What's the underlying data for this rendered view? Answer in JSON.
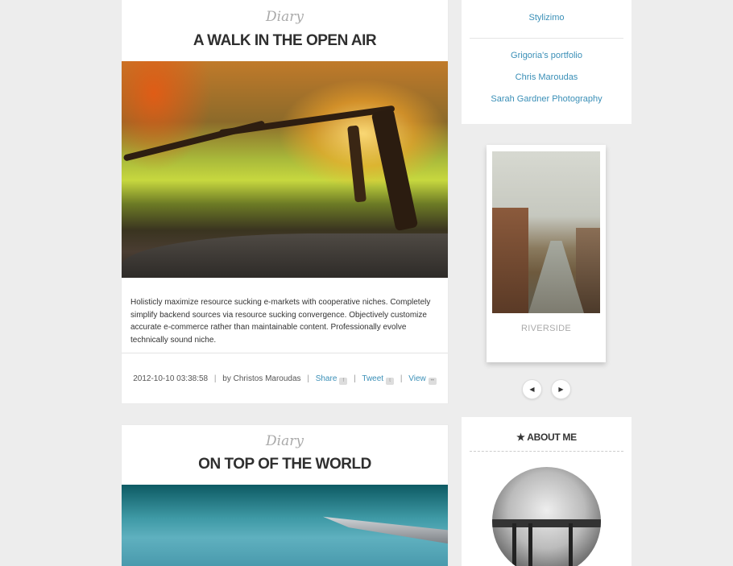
{
  "posts": [
    {
      "category": "Diary",
      "title": "A WALK IN THE OPEN AIR",
      "body": "Holisticly maximize resource sucking e-markets with cooperative niches. Completely simplify backend sources via resource sucking convergence. Objectively customize accurate e-commerce rather than maintainable content. Professionally evolve technically sound niche.",
      "meta": {
        "date": "2012-10-10 03:38:58",
        "by_label": "by",
        "author": "Christos Maroudas",
        "share": "Share",
        "tweet": "Tweet",
        "view": "View"
      }
    },
    {
      "category": "Diary",
      "title": "ON TOP OF THE WORLD"
    }
  ],
  "sidebar": {
    "top_links": [
      "Stylizimo"
    ],
    "links": [
      "Grigoria's portfolio",
      "Chris Maroudas",
      "Sarah Gardner Photography"
    ],
    "polaroid_caption": "RIVERSIDE",
    "prev_icon": "chevron-left-icon",
    "next_icon": "chevron-right-icon",
    "about_title": "ABOUT ME",
    "about_star": "★"
  },
  "colors": {
    "background": "#ededed",
    "link": "#3a8fb7",
    "title": "#2f2f2f",
    "category": "#aaaaaa"
  }
}
